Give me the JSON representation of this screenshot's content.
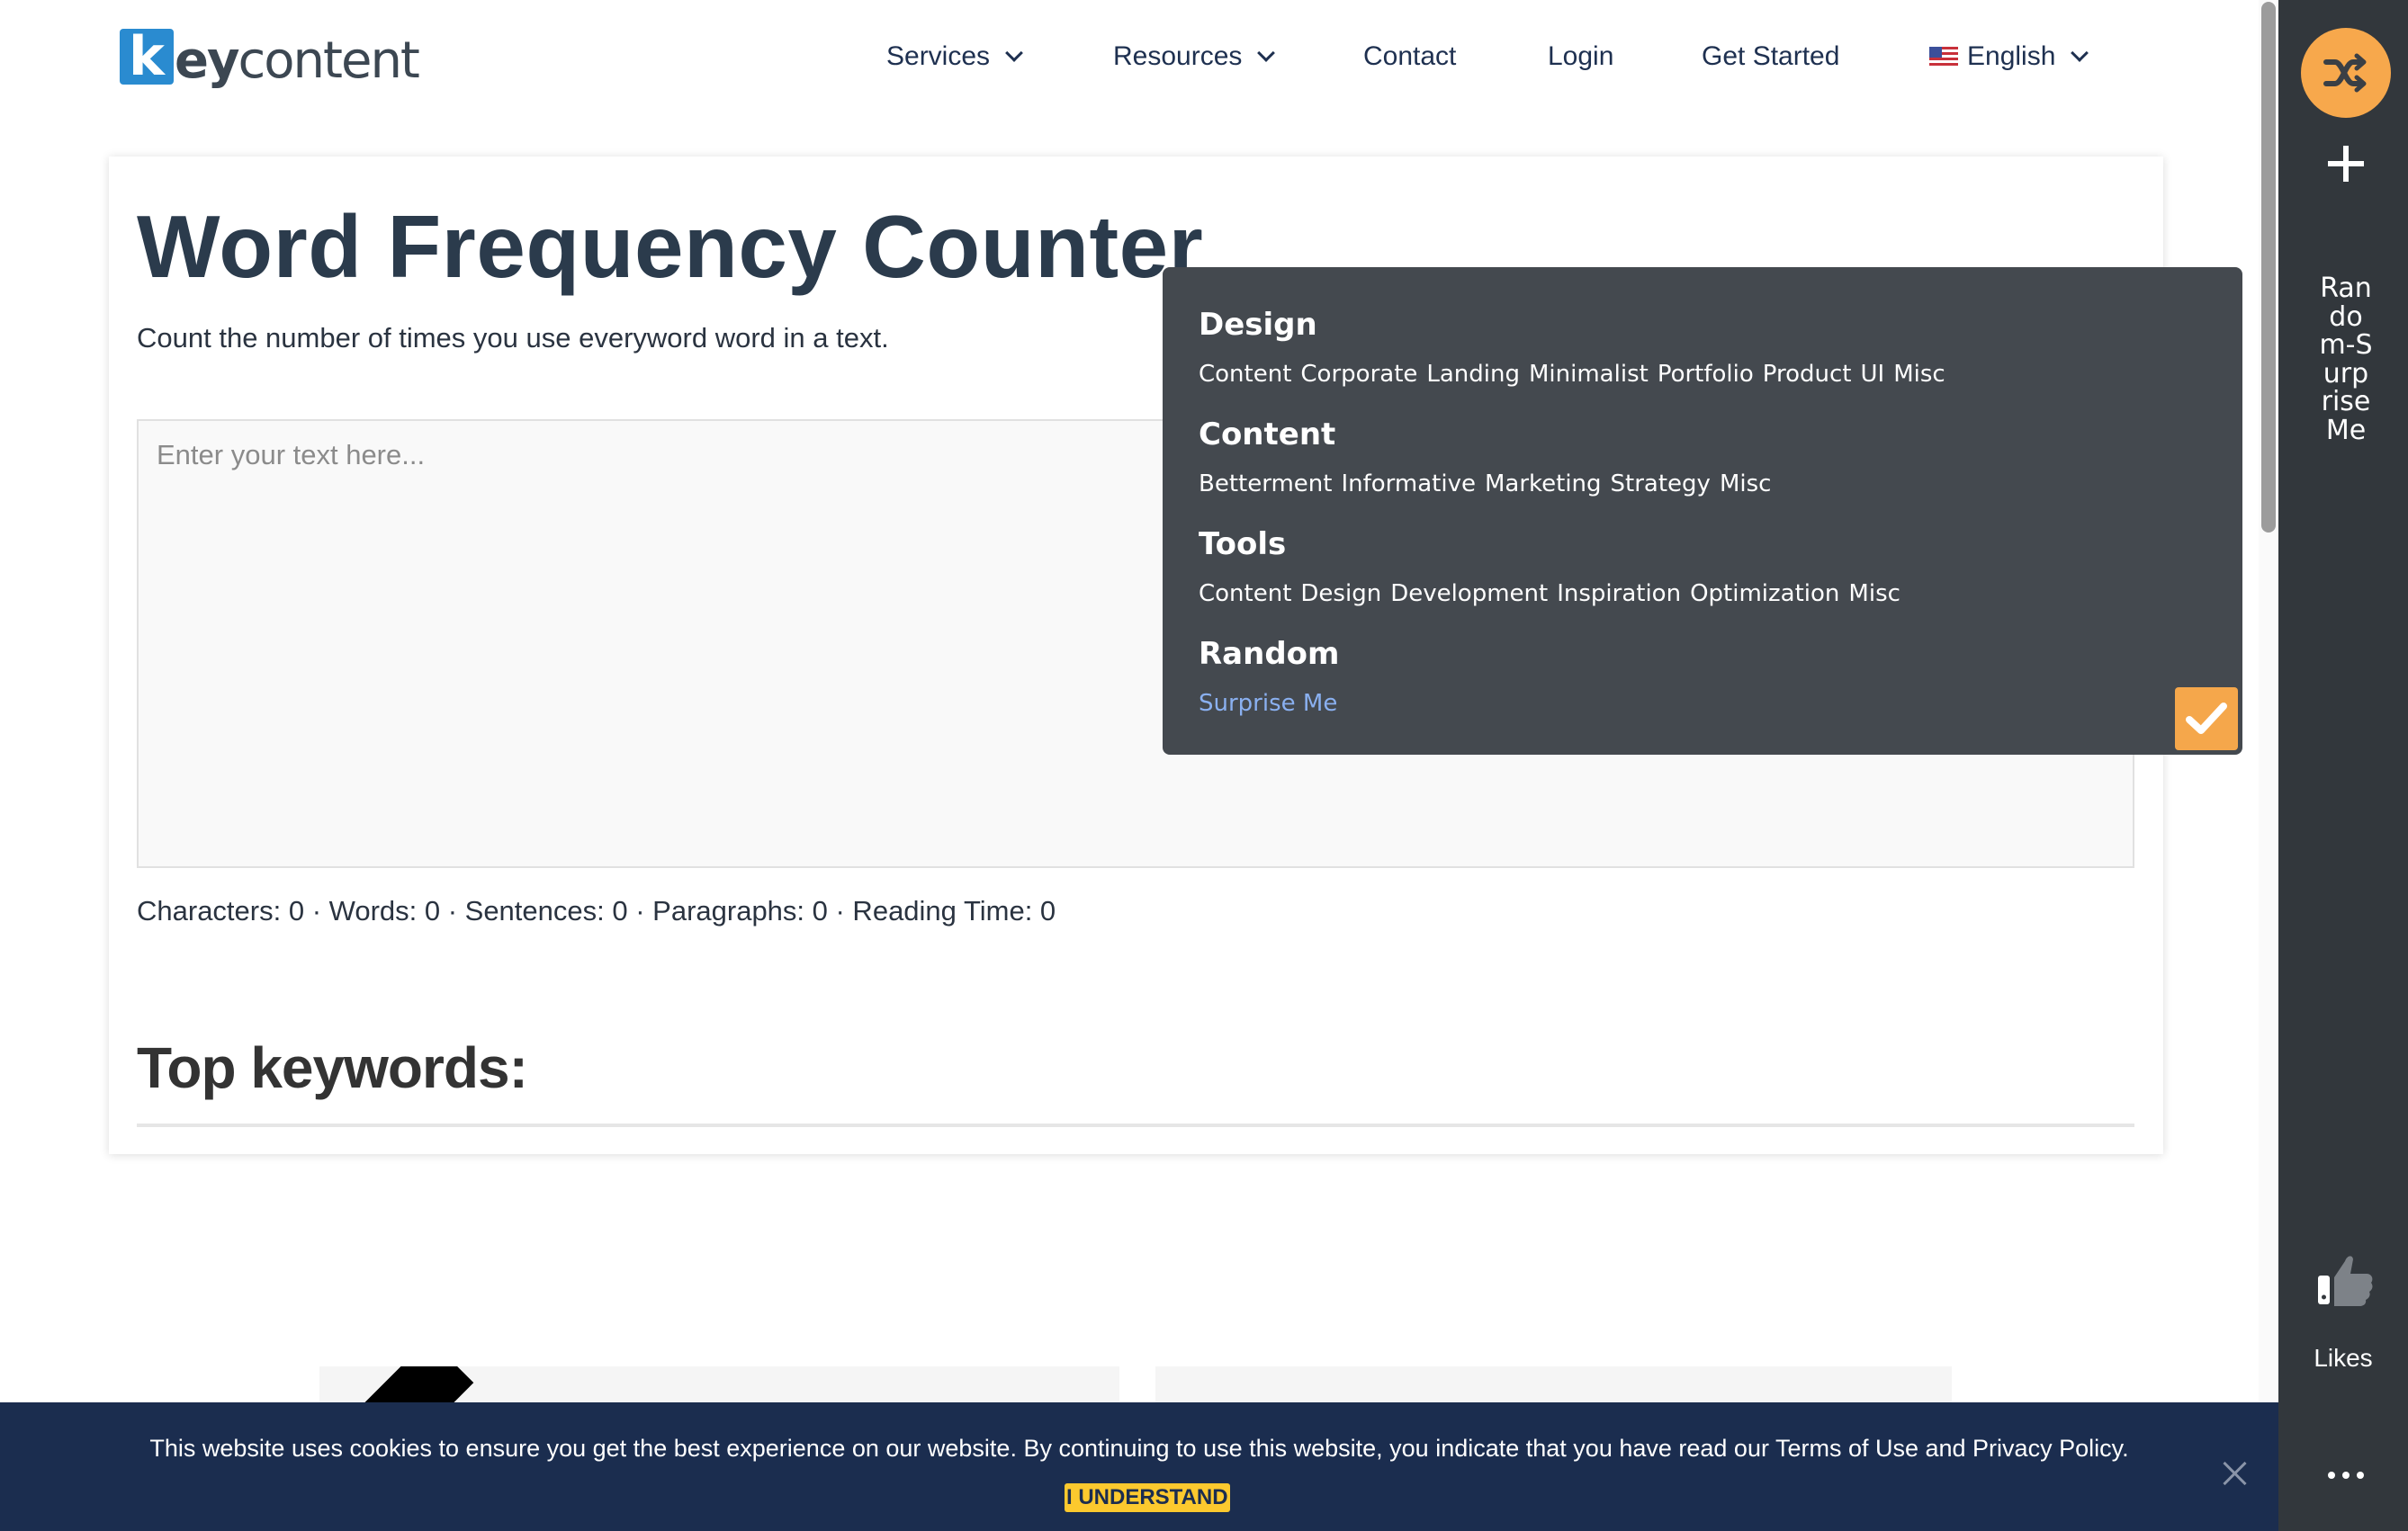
{
  "header": {
    "logo": {
      "k": "k",
      "ey": "ey",
      "rest": "content"
    },
    "nav": [
      {
        "label": "Services",
        "has_dropdown": true
      },
      {
        "label": "Resources",
        "has_dropdown": true
      },
      {
        "label": "Contact",
        "has_dropdown": false
      },
      {
        "label": "Login",
        "has_dropdown": false
      },
      {
        "label": "Get Started",
        "has_dropdown": false
      },
      {
        "label": "English",
        "has_dropdown": true,
        "icon": "us-flag-icon"
      }
    ]
  },
  "main": {
    "title": "Word Frequency Counter",
    "subtitle": "Count the number of times you use everyword word in a text.",
    "textarea_placeholder": "Enter your text here...",
    "stats": "Characters: 0 · Words: 0 · Sentences: 0 · Paragraphs: 0 · Reading Time: 0",
    "top_keywords_heading": "Top keywords:"
  },
  "overlay": {
    "sections": [
      {
        "heading": "Design",
        "links": [
          "Content",
          "Corporate",
          "Landing",
          "Minimalist",
          "Portfolio",
          "Product",
          "UI",
          "Misc"
        ]
      },
      {
        "heading": "Content",
        "links": [
          "Betterment",
          "Informative",
          "Marketing",
          "Strategy",
          "Misc"
        ]
      },
      {
        "heading": "Tools",
        "links": [
          "Content",
          "Design",
          "Development",
          "Inspiration",
          "Optimization",
          "Misc"
        ]
      },
      {
        "heading": "Random",
        "links": [
          "Surprise Me"
        ],
        "accent": true
      }
    ],
    "accent_color": "#8ab0f0",
    "check_color": "#f5a74b"
  },
  "sidebar": {
    "vertical_label": "Random-Surprise Me",
    "likes_label": "Likes",
    "shuffle_color": "#f7a84c"
  },
  "cookie": {
    "text": "This website uses cookies to ensure you get the best experience on our website. By continuing to use this website, you indicate that you have read our Terms of Use and Privacy Policy.",
    "button": "I UNDERSTAND",
    "button_color": "#fcc92e",
    "bar_color": "#1b2d4f"
  }
}
